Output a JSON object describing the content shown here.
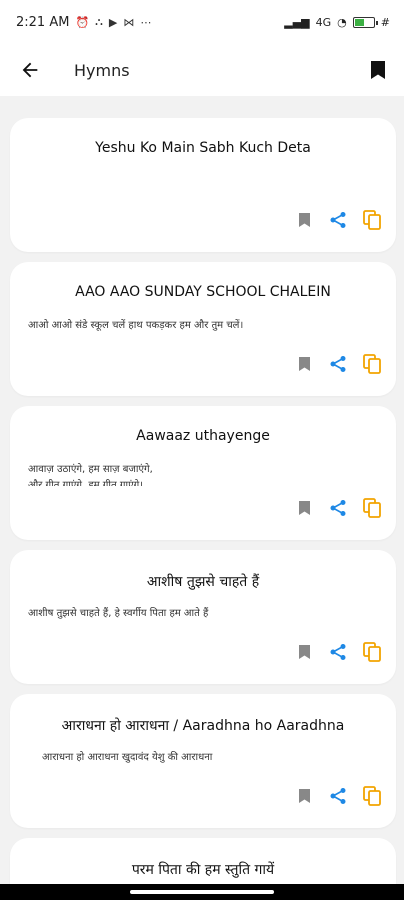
{
  "status_bar": {
    "time": "2:21 AM",
    "icons": [
      "alarm-icon",
      "people-icon",
      "play-icon",
      "gallery-icon",
      "more-dots-icon"
    ],
    "network": "4G",
    "battery_icon": "battery-icon",
    "hash": "#"
  },
  "app_bar": {
    "back_icon": "arrow-left-icon",
    "title": "Hymns",
    "bookmark_icon": "bookmark-filled-icon"
  },
  "colors": {
    "share": "#1e88e5",
    "copy": "#f2a400",
    "bookmark": "#888888"
  },
  "hymns": [
    {
      "title": "Yeshu Ko Main Sabh Kuch Deta",
      "preview": ""
    },
    {
      "title": "AAO AAO SUNDAY SCHOOL CHALEIN",
      "preview": "आओ आओ संडे स्कूल चलें हाथ पकड़कर हम और तुम चलें।"
    },
    {
      "title": "Aawaaz uthayenge",
      "preview": "आवाज़ उठाएंगे, हम साज़ बजाएंगे,\nऔर गीत गाएंगे, हम गीत गाएंगे।"
    },
    {
      "title": "आशीष तुझसे चाहते हैं",
      "preview": "आशीष तुझसे चाहते हैं, हे स्वर्गीय पिता हम आते हैं"
    },
    {
      "title": "आराधना हो आराधना / Aaradhna ho Aaradhna",
      "preview": "आराधना हो आराधना  खुदावंद येशु की आराधना"
    },
    {
      "title": "परम पिता की हम स्तुति गायें",
      "preview": ""
    }
  ]
}
